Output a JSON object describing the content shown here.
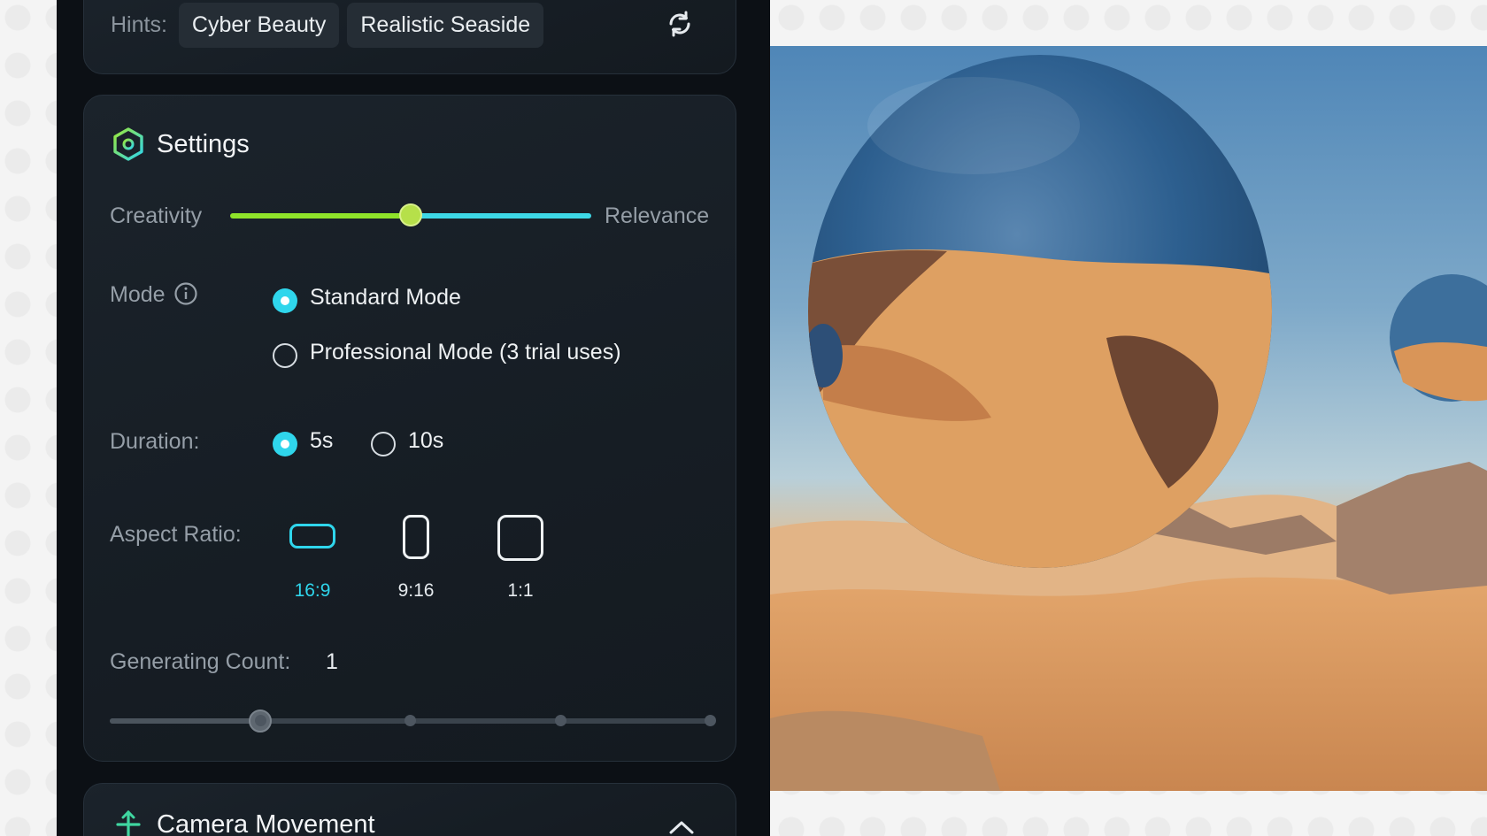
{
  "hints": {
    "label": "Hints:",
    "chips": [
      "Cyber Beauty",
      "Realistic Seaside"
    ]
  },
  "settings": {
    "title": "Settings",
    "slider": {
      "left_label": "Creativity",
      "right_label": "Relevance",
      "value": 0.5
    },
    "mode": {
      "label": "Mode",
      "options": [
        "Standard Mode",
        "Professional Mode (3 trial uses)"
      ],
      "selected": "Standard Mode"
    },
    "duration": {
      "label": "Duration:",
      "options": [
        "5s",
        "10s"
      ],
      "selected": "5s"
    },
    "aspect_ratio": {
      "label": "Aspect Ratio:",
      "options": [
        "16:9",
        "9:16",
        "1:1"
      ],
      "selected": "16:9"
    },
    "generating_count": {
      "label": "Generating Count:",
      "value": "1",
      "steps": 4
    }
  },
  "camera": {
    "title": "Camera Movement"
  },
  "colors": {
    "accent": "#2fd6ec",
    "slider_left": "#8fe32a",
    "slider_right": "#3dd8e6",
    "panel_bg": "#0c1015",
    "card_bg": "#1b232b"
  },
  "icons": [
    "refresh-icon",
    "settings-hex-icon",
    "info-icon",
    "camera-movement-icon",
    "chevron-up-icon"
  ]
}
